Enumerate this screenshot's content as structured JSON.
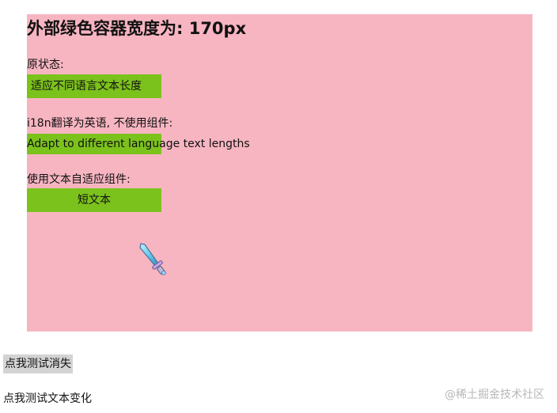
{
  "header": {
    "title": "外部绿色容器宽度为: 170px"
  },
  "original": {
    "label": "原状态:",
    "box_text": "适应不同语言文本长度"
  },
  "translated": {
    "label": "i18n翻译为英语, 不使用组件:",
    "box_text": "Adapt to different language text lengths"
  },
  "adaptive": {
    "label": "使用文本自适应组件:",
    "box_text": "短文本"
  },
  "actions": {
    "disappear_button": "点我测试消失",
    "text_change_button": "点我测试文本变化"
  },
  "watermark": "@稀土掘金技术社区",
  "colors": {
    "pink_background": "#f7b5c1",
    "green_container": "#7cc21c",
    "button_gray": "#d3d3d3"
  },
  "icons": {
    "cursor": "sword-cursor-icon"
  }
}
